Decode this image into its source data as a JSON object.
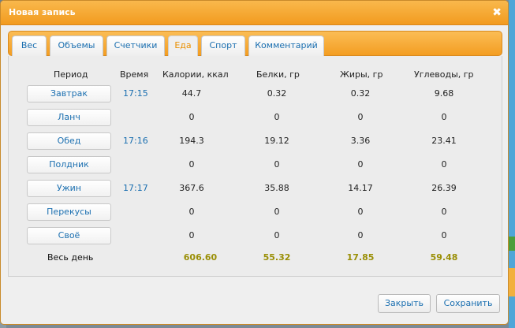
{
  "dialog": {
    "title": "Новая запись",
    "close_glyph": "✖"
  },
  "tabs": [
    {
      "label": "Вес",
      "active": false
    },
    {
      "label": "Объемы",
      "active": false
    },
    {
      "label": "Счетчики",
      "active": false
    },
    {
      "label": "Еда",
      "active": true
    },
    {
      "label": "Спорт",
      "active": false
    },
    {
      "label": "Комментарий",
      "active": false
    }
  ],
  "table": {
    "headers": {
      "period": "Период",
      "time": "Время",
      "calories": "Калории, ккал",
      "protein": "Белки, гр",
      "fat": "Жиры, гр",
      "carbs": "Углеводы, гр"
    },
    "rows": [
      {
        "period": "Завтрак",
        "time": "17:15",
        "calories": "44.7",
        "protein": "0.32",
        "fat": "0.32",
        "carbs": "9.68"
      },
      {
        "period": "Ланч",
        "time": "",
        "calories": "0",
        "protein": "0",
        "fat": "0",
        "carbs": "0"
      },
      {
        "period": "Обед",
        "time": "17:16",
        "calories": "194.3",
        "protein": "19.12",
        "fat": "3.36",
        "carbs": "23.41"
      },
      {
        "period": "Полдник",
        "time": "",
        "calories": "0",
        "protein": "0",
        "fat": "0",
        "carbs": "0"
      },
      {
        "period": "Ужин",
        "time": "17:17",
        "calories": "367.6",
        "protein": "35.88",
        "fat": "14.17",
        "carbs": "26.39"
      },
      {
        "period": "Перекусы",
        "time": "",
        "calories": "0",
        "protein": "0",
        "fat": "0",
        "carbs": "0"
      },
      {
        "period": "Своё",
        "time": "",
        "calories": "0",
        "protein": "0",
        "fat": "0",
        "carbs": "0"
      }
    ],
    "total": {
      "label": "Весь день",
      "calories": "606.60",
      "protein": "55.32",
      "fat": "17.85",
      "carbs": "59.48"
    }
  },
  "footer": {
    "close_label": "Закрыть",
    "save_label": "Сохранить"
  },
  "colors": {
    "accent_orange": "#f29b1f",
    "link_blue": "#1b6fb0",
    "total_olive": "#9a8f06",
    "active_tab_orange": "#e98f00"
  }
}
